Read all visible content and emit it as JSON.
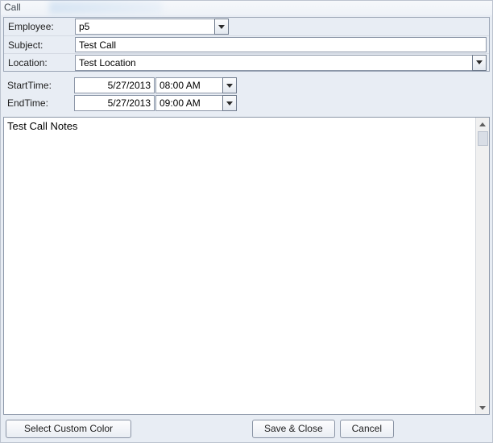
{
  "window": {
    "title": "Call"
  },
  "labels": {
    "employee": "Employee:",
    "subject": "Subject:",
    "location": "Location:",
    "startTime": "StartTime:",
    "endTime": "EndTime:"
  },
  "fields": {
    "employee": "p5",
    "subject": "Test Call",
    "location": "Test Location",
    "startDate": "5/27/2013",
    "startTime": "08:00 AM",
    "endDate": "5/27/2013",
    "endTime": "09:00 AM",
    "notes": "Test Call Notes"
  },
  "buttons": {
    "selectColor": "Select Custom Color",
    "saveClose": "Save & Close",
    "cancel": "Cancel"
  }
}
